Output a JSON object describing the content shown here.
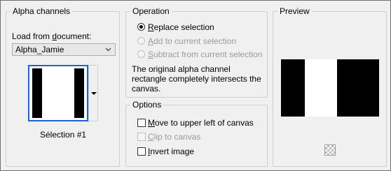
{
  "alpha_channels": {
    "title": "Alpha channels",
    "load_label": "Load from document:",
    "load_label_parts": [
      "Load from ",
      "d",
      "ocument:"
    ],
    "document": "Alpha_Jamie",
    "selection_name": "Sélection #1"
  },
  "operation": {
    "title": "Operation",
    "options": [
      {
        "pre": "",
        "u": "R",
        "post": "eplace selection",
        "selected": true,
        "enabled": true
      },
      {
        "pre": "",
        "u": "A",
        "post": "dd to current selection",
        "selected": false,
        "enabled": false
      },
      {
        "pre": "",
        "u": "S",
        "post": "ubtract from current selection",
        "selected": false,
        "enabled": false
      }
    ],
    "info_text": "The original alpha channel rectangle completely intersects the canvas."
  },
  "options": {
    "title": "Options",
    "items": [
      {
        "u": "M",
        "post": "ove to upper left of canvas",
        "checked": false,
        "enabled": true
      },
      {
        "u": "C",
        "post": "lip to canvas",
        "checked": false,
        "enabled": false
      },
      {
        "u": "I",
        "post": "nvert image",
        "checked": false,
        "enabled": true
      }
    ]
  },
  "preview": {
    "title": "Preview",
    "background_icon": "transparency-checker-icon"
  },
  "colors": {
    "thumb_border": "#2060d8",
    "panel_bg": "#f0f0f0"
  }
}
